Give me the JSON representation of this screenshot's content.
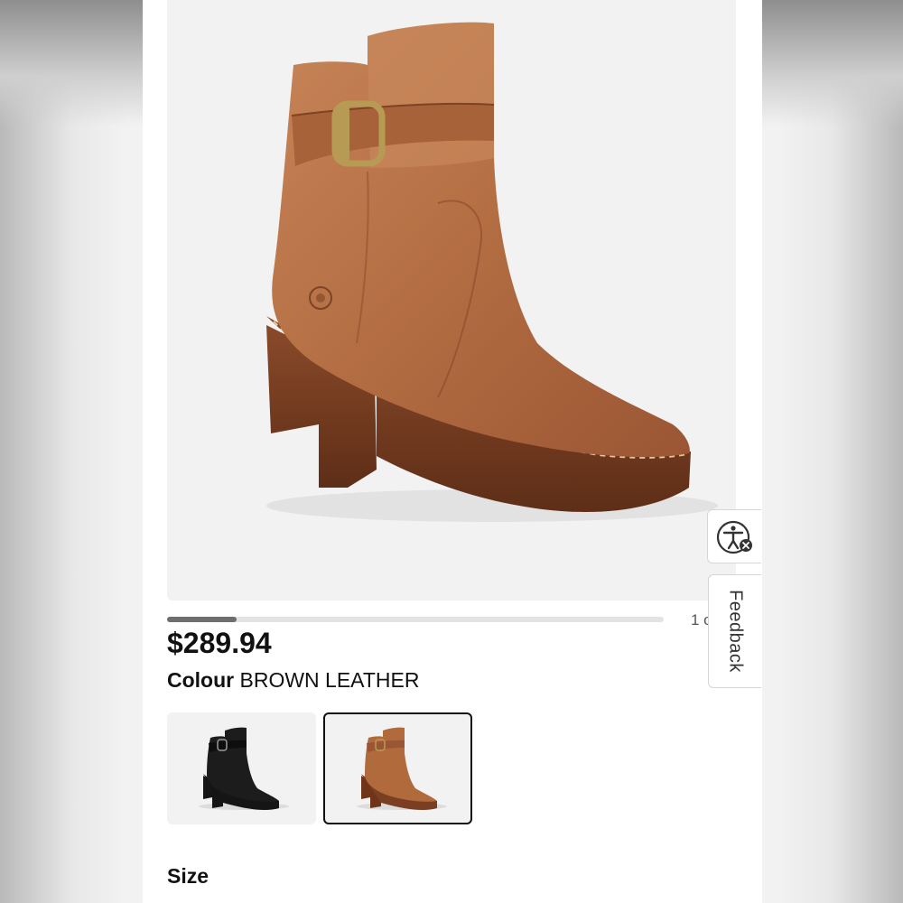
{
  "product": {
    "price": "$289.94",
    "colour_label": "Colour",
    "colour_value": "BROWN LEATHER",
    "size_label": "Size"
  },
  "gallery": {
    "counter": "1 of",
    "progress_fraction": 0.14
  },
  "swatches": [
    {
      "name": "black",
      "selected": false,
      "color": "#1c1c1c"
    },
    {
      "name": "brown",
      "selected": true,
      "color": "#b06a3c"
    }
  ],
  "side_widgets": {
    "accessibility_icon": "accessibility-icon",
    "feedback_label": "Feedback"
  },
  "colors": {
    "leather": "#b5714a",
    "sole": "#7a3f22",
    "buckle": "#b79a54"
  }
}
